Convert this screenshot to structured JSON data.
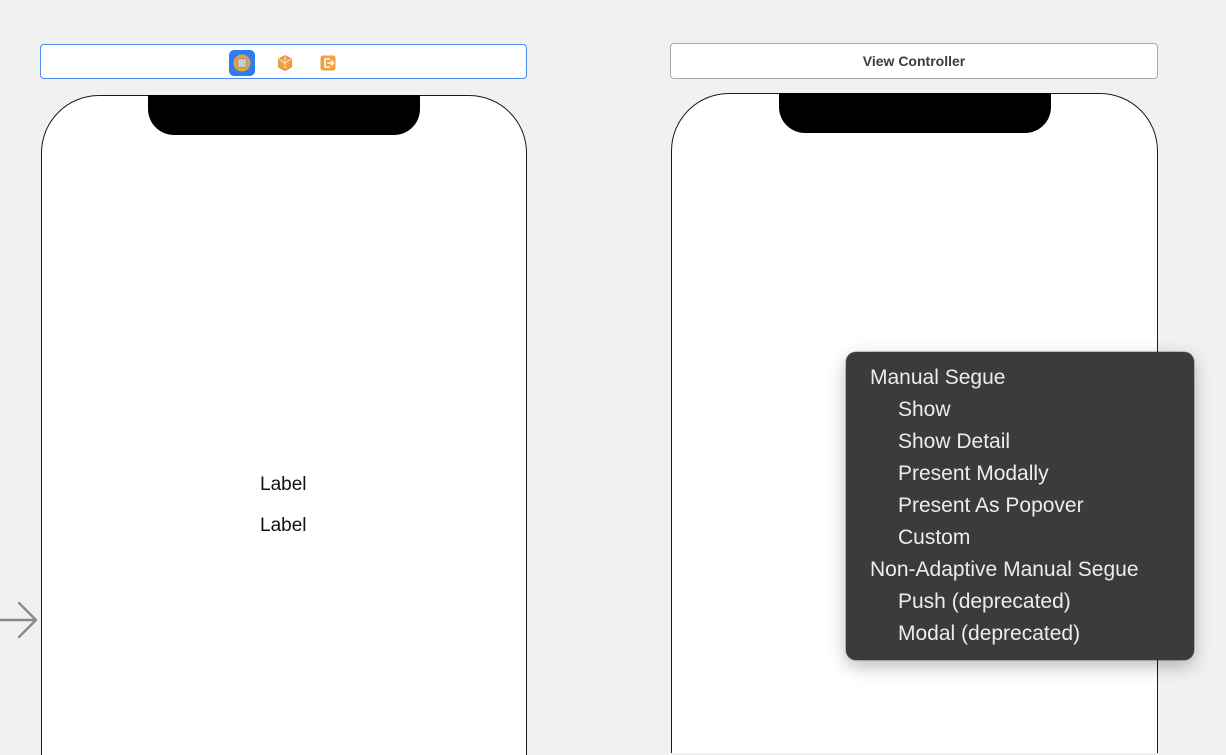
{
  "left_scene": {
    "dock": {
      "icons": [
        "view-controller-icon",
        "first-responder-icon",
        "exit-icon"
      ],
      "colors": {
        "selected_bg": "#2f7bf0",
        "orange": "#f0a040"
      }
    },
    "labels": [
      "Label",
      "Label"
    ]
  },
  "right_scene": {
    "title": "View Controller"
  },
  "segue_menu": {
    "sections": [
      {
        "header": "Manual Segue",
        "items": [
          "Show",
          "Show Detail",
          "Present Modally",
          "Present As Popover",
          "Custom"
        ]
      },
      {
        "header": "Non-Adaptive Manual Segue",
        "items": [
          "Push (deprecated)",
          "Modal (deprecated)"
        ]
      }
    ]
  }
}
